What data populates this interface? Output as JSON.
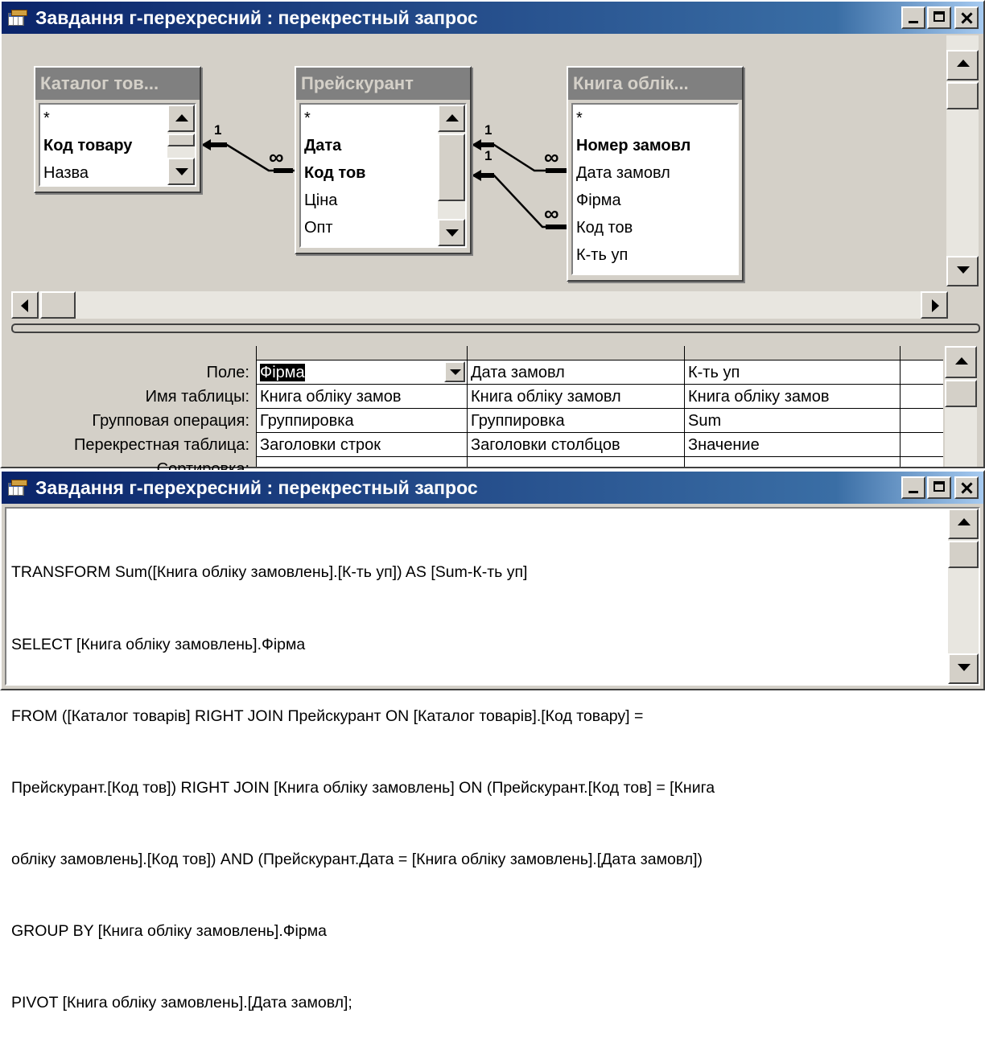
{
  "query_design_window": {
    "title": "Завдання г-перехресний : перекрестный запрос",
    "tables": [
      {
        "caption": "Каталог тов...",
        "fields": [
          {
            "label": "*",
            "key": false
          },
          {
            "label": "Код товару",
            "key": true
          },
          {
            "label": "Назва",
            "key": false
          }
        ]
      },
      {
        "caption": "Прейскурант",
        "fields": [
          {
            "label": "*",
            "key": false
          },
          {
            "label": "Дата",
            "key": true
          },
          {
            "label": "Код тов",
            "key": true
          },
          {
            "label": "Ціна",
            "key": false
          },
          {
            "label": "Опт",
            "key": false
          }
        ]
      },
      {
        "caption": "Книга облік...",
        "fields": [
          {
            "label": "*",
            "key": false
          },
          {
            "label": "Номер замовл",
            "key": true
          },
          {
            "label": "Дата замовл",
            "key": false
          },
          {
            "label": "Фірма",
            "key": false
          },
          {
            "label": "Код тов",
            "key": false
          },
          {
            "label": "К-ть уп",
            "key": false
          }
        ]
      }
    ],
    "relationships": [
      {
        "one": "1",
        "many": "∞"
      },
      {
        "one": "1",
        "many": "∞"
      },
      {
        "one": "1",
        "many": "∞"
      }
    ],
    "grid": {
      "row_labels": [
        "Поле:",
        "Имя таблицы:",
        "Групповая операция:",
        "Перекрестная таблица:",
        "Сортировка:"
      ],
      "columns": [
        {
          "field": "Фірма",
          "table": "Книга обліку замов",
          "group": "Группировка",
          "crosstab": "Заголовки строк"
        },
        {
          "field": "Дата замовл",
          "table": "Книга обліку замовл",
          "group": "Группировка",
          "crosstab": "Заголовки столбцов"
        },
        {
          "field": "К-ть уп",
          "table": "Книга обліку замов",
          "group": "Sum",
          "crosstab": "Значение"
        }
      ]
    }
  },
  "sql_window": {
    "title": "Завдання г-перехресний : перекрестный запрос",
    "lines": [
      "TRANSFORM Sum([Книга обліку замовлень].[К-ть уп]) AS [Sum-К-ть уп]",
      "SELECT [Книга обліку замовлень].Фірма",
      "FROM ([Каталог товарів] RIGHT JOIN Прейскурант ON [Каталог товарів].[Код товару] =",
      "Прейскурант.[Код тов]) RIGHT JOIN [Книга обліку замовлень] ON (Прейскурант.[Код тов] = [Книга",
      "обліку замовлень].[Код тов]) AND (Прейскурант.Дата = [Книга обліку замовлень].[Дата замовл])",
      "GROUP BY [Книга обліку замовлень].Фірма",
      "PIVOT [Книга обліку замовлень].[Дата замовл];"
    ]
  }
}
